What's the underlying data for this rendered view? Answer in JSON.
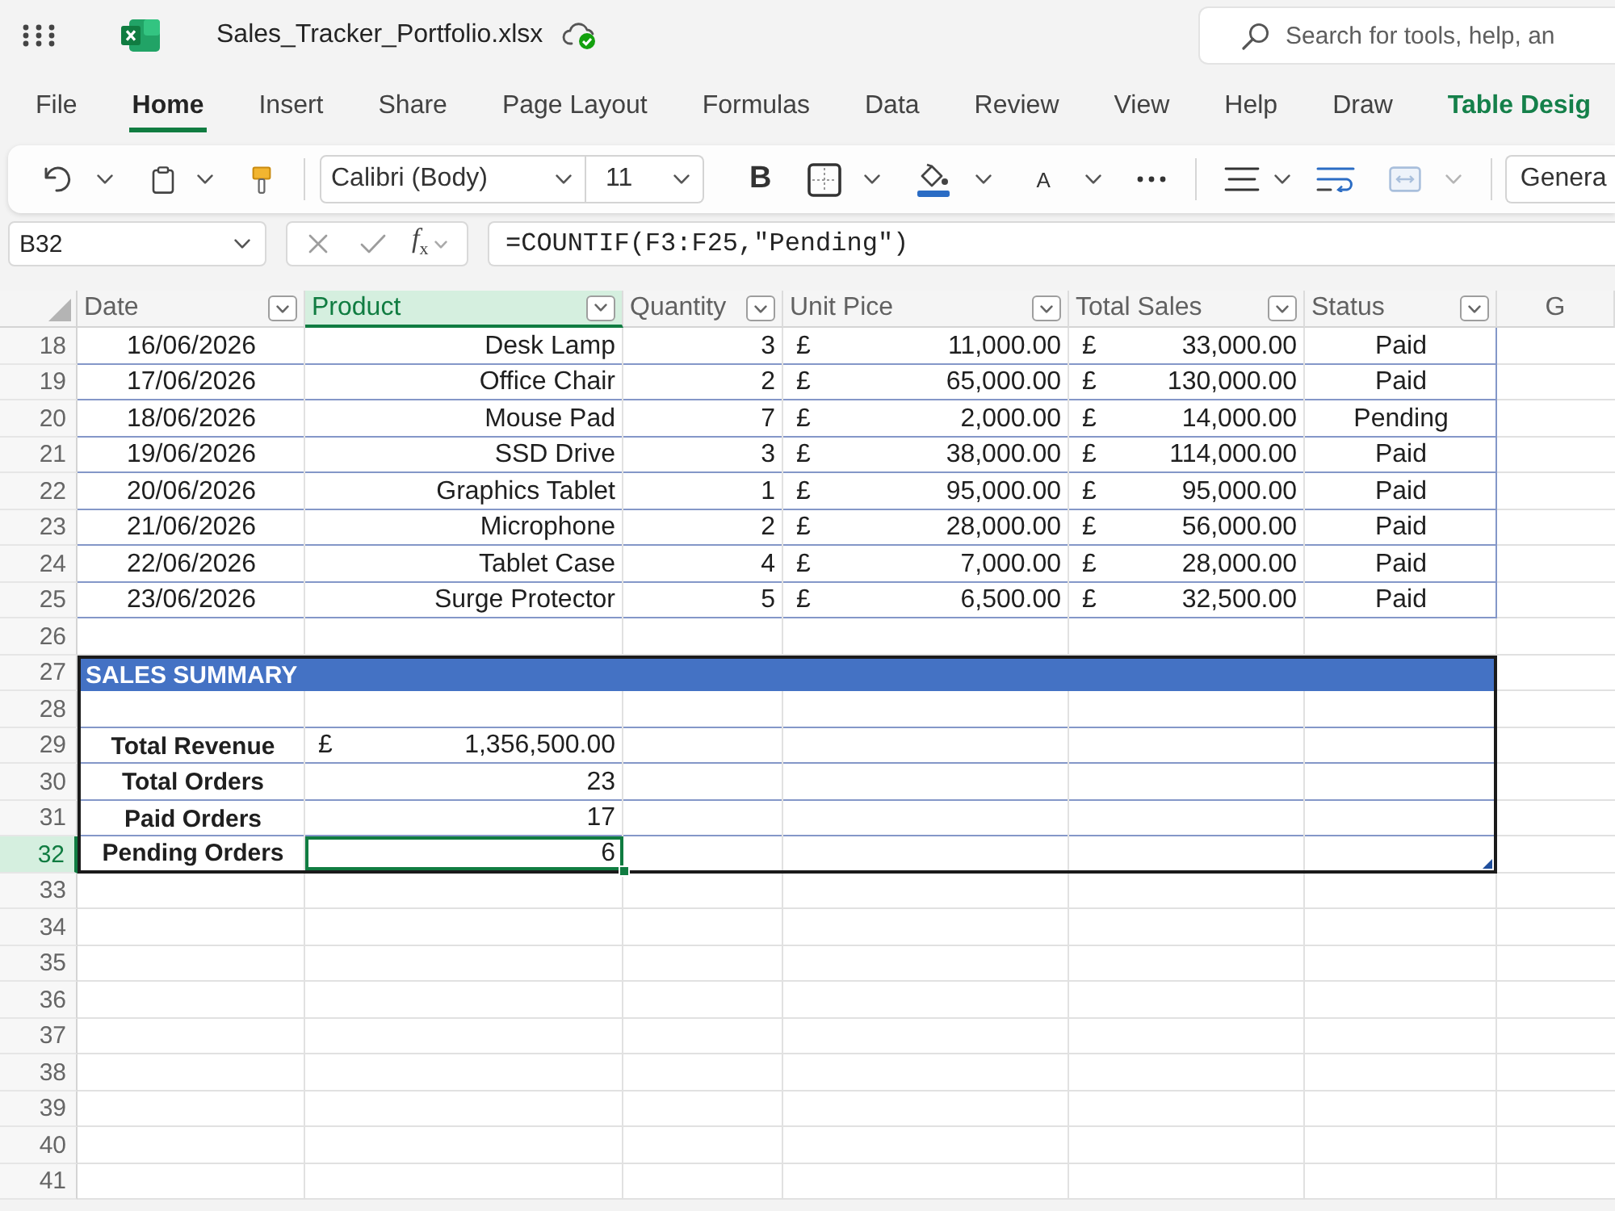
{
  "title_bar": {
    "file_name": "Sales_Tracker_Portfolio.xlsx",
    "search": {
      "placeholder": "Search for tools, help, an"
    }
  },
  "ribbon_tabs": [
    {
      "label": "File",
      "kind": "standard",
      "selected": false
    },
    {
      "label": "Home",
      "kind": "standard",
      "selected": true
    },
    {
      "label": "Insert",
      "kind": "standard",
      "selected": false
    },
    {
      "label": "Share",
      "kind": "standard",
      "selected": false
    },
    {
      "label": "Page Layout",
      "kind": "standard",
      "selected": false
    },
    {
      "label": "Formulas",
      "kind": "standard",
      "selected": false
    },
    {
      "label": "Data",
      "kind": "standard",
      "selected": false
    },
    {
      "label": "Review",
      "kind": "standard",
      "selected": false
    },
    {
      "label": "View",
      "kind": "standard",
      "selected": false
    },
    {
      "label": "Help",
      "kind": "standard",
      "selected": false
    },
    {
      "label": "Draw",
      "kind": "standard",
      "selected": false
    },
    {
      "label": "Table Desig",
      "kind": "contextual",
      "selected": false
    }
  ],
  "toolbar": {
    "font_name": "Calibri (Body)",
    "font_size": "11",
    "bold_button": "B",
    "font_color_button": "A",
    "number_format": "Genera"
  },
  "formula_bar": {
    "name_box": "B32",
    "function_button": "f$_{x}$",
    "formula": "=COUNTIF(F3:F25,\"Pending\")"
  },
  "sheet": {
    "columns": [
      {
        "label": "Date",
        "kind": "table_header",
        "selected": false
      },
      {
        "label": "Product",
        "kind": "table_header",
        "selected": true
      },
      {
        "label": "Quantity",
        "kind": "table_header",
        "selected": false
      },
      {
        "label": "Unit Pice",
        "kind": "table_header",
        "selected": false
      },
      {
        "label": "Total Sales",
        "kind": "table_header",
        "selected": false
      },
      {
        "label": "Status",
        "kind": "table_header",
        "selected": false
      },
      {
        "label": "G",
        "kind": "letter",
        "selected": false
      }
    ],
    "rows": [
      {
        "number": "18",
        "kind": "data",
        "selected": false,
        "date": "16/06/2026",
        "product": "Desk Lamp",
        "quantity": "3",
        "unit_price": {
          "currency": "£",
          "amount": "11,000.00"
        },
        "total_sales": {
          "currency": "£",
          "amount": "33,000.00"
        },
        "status": "Paid"
      },
      {
        "number": "19",
        "kind": "data",
        "selected": false,
        "date": "17/06/2026",
        "product": "Office Chair",
        "quantity": "2",
        "unit_price": {
          "currency": "£",
          "amount": "65,000.00"
        },
        "total_sales": {
          "currency": "£",
          "amount": "130,000.00"
        },
        "status": "Paid"
      },
      {
        "number": "20",
        "kind": "data",
        "selected": false,
        "date": "18/06/2026",
        "product": "Mouse Pad",
        "quantity": "7",
        "unit_price": {
          "currency": "£",
          "amount": "2,000.00"
        },
        "total_sales": {
          "currency": "£",
          "amount": "14,000.00"
        },
        "status": "Pending"
      },
      {
        "number": "21",
        "kind": "data",
        "selected": false,
        "date": "19/06/2026",
        "product": "SSD Drive",
        "quantity": "3",
        "unit_price": {
          "currency": "£",
          "amount": "38,000.00"
        },
        "total_sales": {
          "currency": "£",
          "amount": "114,000.00"
        },
        "status": "Paid"
      },
      {
        "number": "22",
        "kind": "data",
        "selected": false,
        "date": "20/06/2026",
        "product": "Graphics Tablet",
        "quantity": "1",
        "unit_price": {
          "currency": "£",
          "amount": "95,000.00"
        },
        "total_sales": {
          "currency": "£",
          "amount": "95,000.00"
        },
        "status": "Paid"
      },
      {
        "number": "23",
        "kind": "data",
        "selected": false,
        "date": "21/06/2026",
        "product": "Microphone",
        "quantity": "2",
        "unit_price": {
          "currency": "£",
          "amount": "28,000.00"
        },
        "total_sales": {
          "currency": "£",
          "amount": "56,000.00"
        },
        "status": "Paid"
      },
      {
        "number": "24",
        "kind": "data",
        "selected": false,
        "date": "22/06/2026",
        "product": "Tablet Case",
        "quantity": "4",
        "unit_price": {
          "currency": "£",
          "amount": "7,000.00"
        },
        "total_sales": {
          "currency": "£",
          "amount": "28,000.00"
        },
        "status": "Paid"
      },
      {
        "number": "25",
        "kind": "data",
        "selected": false,
        "date": "23/06/2026",
        "product": "Surge Protector",
        "quantity": "5",
        "unit_price": {
          "currency": "£",
          "amount": "6,500.00"
        },
        "total_sales": {
          "currency": "£",
          "amount": "32,500.00"
        },
        "status": "Paid"
      },
      {
        "number": "26",
        "kind": "blank",
        "selected": false
      },
      {
        "number": "27",
        "kind": "banner",
        "selected": false,
        "title": "SALES SUMMARY"
      },
      {
        "number": "28",
        "kind": "summary",
        "selected": false
      },
      {
        "number": "29",
        "kind": "summary",
        "selected": false,
        "label": "Total Revenue",
        "value": {
          "currency": "£",
          "amount": "1,356,500.00"
        }
      },
      {
        "number": "30",
        "kind": "summary",
        "selected": false,
        "label": "Total Orders",
        "value": {
          "amount": "23"
        }
      },
      {
        "number": "31",
        "kind": "summary",
        "selected": false,
        "label": "Paid Orders",
        "value": {
          "amount": "17"
        }
      },
      {
        "number": "32",
        "kind": "summary",
        "selected": true,
        "label": "Pending Orders",
        "value": {
          "amount": "6"
        }
      },
      {
        "number": "33",
        "kind": "blank",
        "selected": false
      },
      {
        "number": "34",
        "kind": "blank",
        "selected": false
      },
      {
        "number": "35",
        "kind": "blank",
        "selected": false
      },
      {
        "number": "36",
        "kind": "blank",
        "selected": false
      },
      {
        "number": "37",
        "kind": "blank",
        "selected": false
      },
      {
        "number": "38",
        "kind": "blank",
        "selected": false
      },
      {
        "number": "39",
        "kind": "blank",
        "selected": false
      },
      {
        "number": "40",
        "kind": "blank",
        "selected": false
      },
      {
        "number": "41",
        "kind": "blank",
        "selected": false
      }
    ]
  }
}
